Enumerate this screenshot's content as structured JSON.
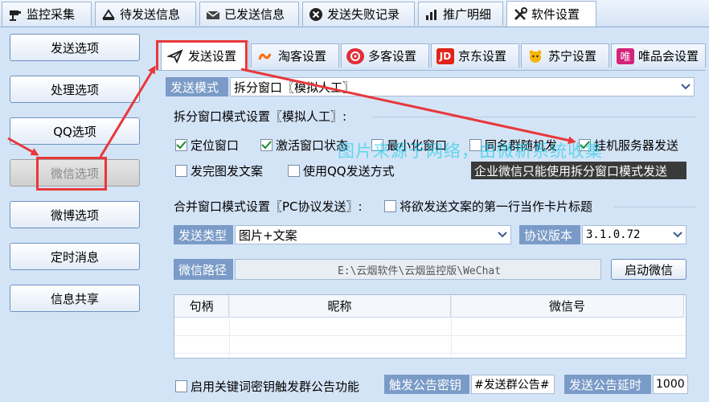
{
  "top_tabs": [
    {
      "label": "监控采集",
      "icon": "camera-icon"
    },
    {
      "label": "待发送信息",
      "icon": "stamp-icon"
    },
    {
      "label": "已发送信息",
      "icon": "envelope-icon"
    },
    {
      "label": "发送失败记录",
      "icon": "close-circle-icon"
    },
    {
      "label": "推广明细",
      "icon": "bar-chart-icon"
    },
    {
      "label": "软件设置",
      "icon": "tools-icon"
    }
  ],
  "sidebar": {
    "items": [
      {
        "label": "发送选项"
      },
      {
        "label": "处理选项"
      },
      {
        "label": "QQ选项"
      },
      {
        "label": "微信选项"
      },
      {
        "label": "微博选项"
      },
      {
        "label": "定时消息"
      },
      {
        "label": "信息共享"
      }
    ]
  },
  "sub_tabs": [
    {
      "label": "发送设置",
      "icon": "send-icon"
    },
    {
      "label": "淘客设置",
      "icon": "taoke-icon"
    },
    {
      "label": "多客设置",
      "icon": "duoke-icon"
    },
    {
      "label": "京东设置",
      "icon": "jd-icon"
    },
    {
      "label": "苏宁设置",
      "icon": "suning-icon"
    },
    {
      "label": "唯品会设置",
      "icon": "vip-icon"
    }
  ],
  "jd_icon_text": "JD",
  "vip_icon_text": "唯",
  "send_mode": {
    "label": "发送模式",
    "value": "拆分窗口〖模拟人工〗"
  },
  "split_group": {
    "title": "拆分窗口模式设置〖模拟人工〗:",
    "options": [
      {
        "label": "定位窗口",
        "checked": true
      },
      {
        "label": "激活窗口状态",
        "checked": true
      },
      {
        "label": "最小化窗口",
        "checked": false
      },
      {
        "label": "同名群随机发",
        "checked": false
      },
      {
        "label": "挂机服务器发送",
        "checked": true
      },
      {
        "label": "发完图发文案",
        "checked": false
      },
      {
        "label": "使用QQ发送方式",
        "checked": false
      }
    ],
    "note": "企业微信只能使用拆分窗口模式发送"
  },
  "merge_group": {
    "title": "合并窗口模式设置〖PC协议发送〗:",
    "card_title_option": {
      "label": "将欲发送文案的第一行当作卡片标题",
      "checked": false
    },
    "send_type": {
      "label": "发送类型",
      "value": "图片+文案"
    },
    "protocol": {
      "label": "协议版本",
      "value": "3.1.0.72"
    },
    "wechat_path": {
      "label": "微信路径",
      "value": "E:\\云烟软件\\云烟监控版\\WeChat"
    },
    "start_button": "启动微信",
    "table": {
      "columns": [
        "句柄",
        "昵称",
        "微信号"
      ],
      "rows": []
    }
  },
  "bottom": {
    "keyword_option": {
      "label": "启用关键词密钥触发群公告功能",
      "checked": false
    },
    "key_label": "触发公告密钥",
    "key_value": "#发送群公告#",
    "delay_label": "发送公告延时",
    "delay_value": "1000"
  },
  "watermark": "图片来源于网络，由微新系统收集",
  "colors": {
    "highlight": "#e8383b",
    "label_bg": "#7a9bc7",
    "panel_bg": "#d4e4f7"
  }
}
